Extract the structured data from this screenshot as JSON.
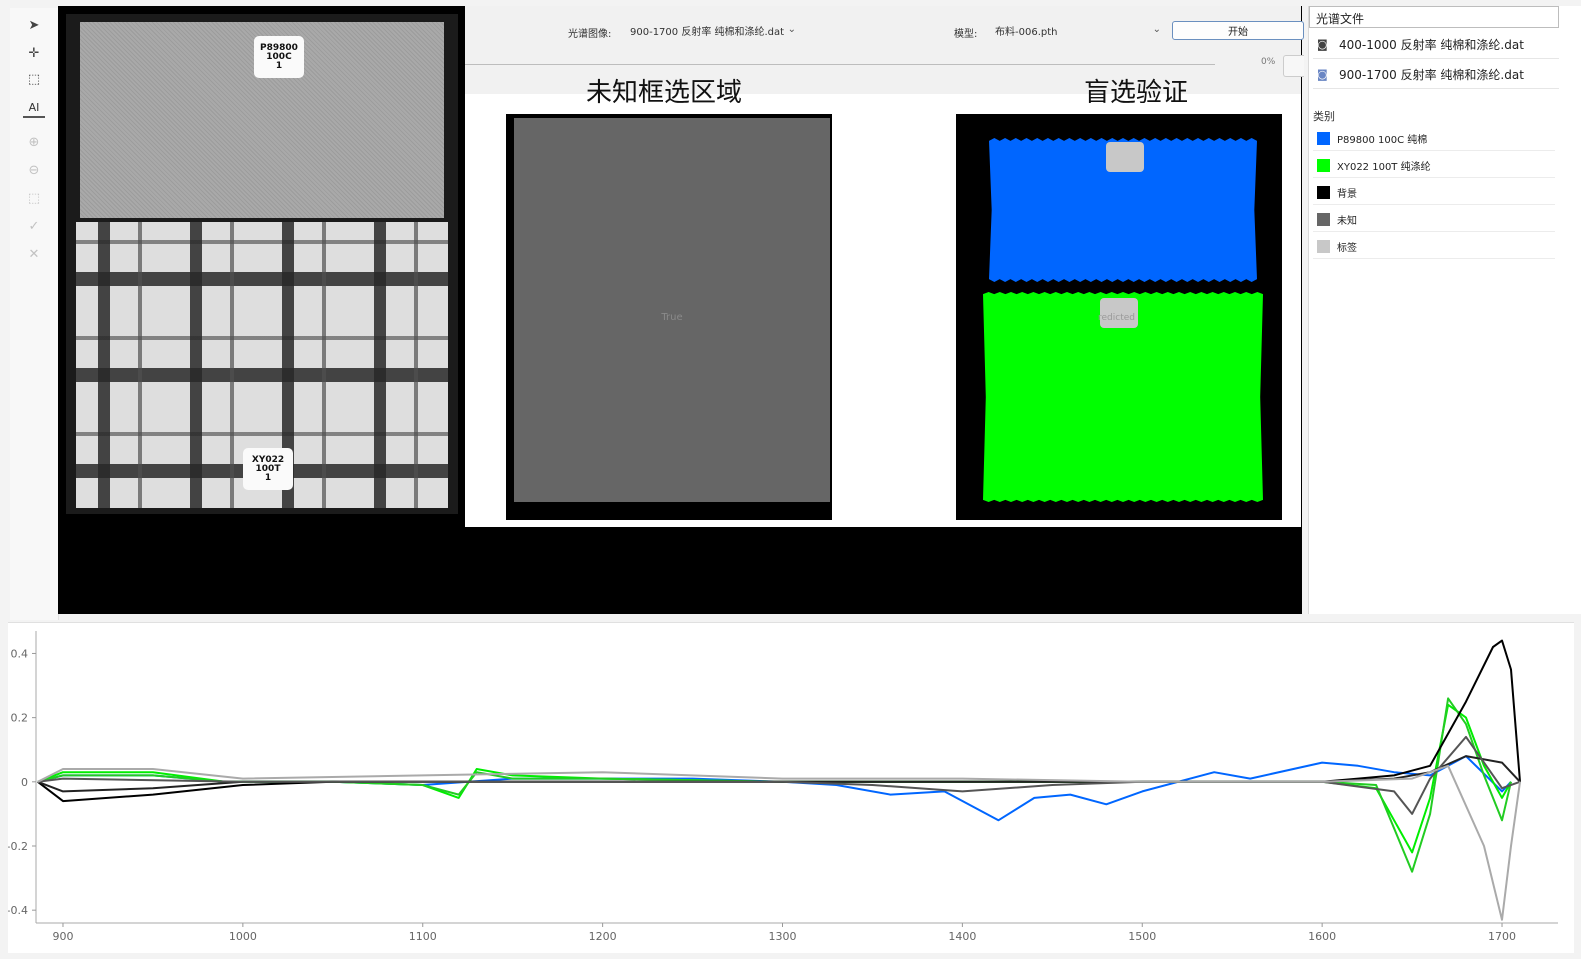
{
  "toolbar_left": {
    "tools": [
      {
        "name": "pointer-icon",
        "glyph": "➤",
        "enabled": true
      },
      {
        "name": "crosshair-icon",
        "glyph": "✛",
        "enabled": false
      },
      {
        "name": "rect-select-icon",
        "glyph": "⬚",
        "enabled": true
      },
      {
        "name": "ai-tool",
        "glyph": "AI",
        "enabled": true
      },
      {
        "name": "add-circle-icon",
        "glyph": "⊕",
        "enabled": false
      },
      {
        "name": "remove-circle-icon",
        "glyph": "⊖",
        "enabled": false
      },
      {
        "name": "rect-region-icon",
        "glyph": "⬚",
        "enabled": false
      },
      {
        "name": "check-icon",
        "glyph": "✓",
        "enabled": false
      },
      {
        "name": "close-icon",
        "glyph": "✕",
        "enabled": false
      }
    ]
  },
  "source_image": {
    "tag_top": "P89800\n100C\n1",
    "tag_bottom": "XY022\n100T\n1"
  },
  "controls": {
    "spectral_image_label": "光谱图像:",
    "spectral_image_value": "900-1700  反射率 纯棉和涤纶.dat",
    "model_label": "模型:",
    "model_value": "布料-006.pth",
    "start_button": "开始",
    "progress_text": "0%"
  },
  "figure": {
    "left_title": "未知框选区域",
    "right_title": "盲选验证",
    "left_inner_label": "True",
    "right_inner_label": "redicted"
  },
  "sidebar": {
    "files_header": "光谱文件",
    "files": [
      {
        "label": "400-1000 反射率 纯棉和涤纶.dat",
        "icon": "camera-icon"
      },
      {
        "label": "900-1700  反射率 纯棉和涤纶.dat",
        "icon": "camera-icon"
      }
    ],
    "class_header": "类别",
    "classes": [
      {
        "label": "P89800 100C 纯棉",
        "color": "#0066ff"
      },
      {
        "label": "XY022 100T 纯涤纶",
        "color": "#00ff00"
      },
      {
        "label": "背景",
        "color": "#000000"
      },
      {
        "label": "未知",
        "color": "#666666"
      },
      {
        "label": "标签",
        "color": "#c8c8c8"
      }
    ]
  },
  "chart_data": {
    "type": "line",
    "title": "",
    "xlabel": "",
    "ylabel": "",
    "xlim": [
      885,
      1720
    ],
    "ylim": [
      -0.44,
      0.47
    ],
    "xticks": [
      900,
      1000,
      1100,
      1200,
      1300,
      1400,
      1500,
      1600,
      1700
    ],
    "yticks": [
      0.4,
      0.2,
      0,
      -0.2,
      -0.4
    ],
    "ytick_labels": [
      "0.4",
      "0.2",
      "0",
      "-0.2",
      "-0.4"
    ],
    "grid": false,
    "series": [
      {
        "color": "#0066ff",
        "x": [
          886,
          900,
          950,
          990,
          1050,
          1100,
          1150,
          1200,
          1250,
          1300,
          1330,
          1360,
          1390,
          1420,
          1440,
          1460,
          1480,
          1500,
          1540,
          1560,
          1600,
          1620,
          1640,
          1660,
          1680,
          1700,
          1705
        ],
        "y": [
          0,
          0.02,
          0.02,
          0,
          0,
          -0.01,
          0.01,
          0.01,
          0.01,
          0,
          -0.01,
          -0.04,
          -0.03,
          -0.12,
          -0.05,
          -0.04,
          -0.07,
          -0.03,
          0.03,
          0.01,
          0.06,
          0.05,
          0.03,
          0.02,
          0.08,
          -0.03,
          0
        ]
      },
      {
        "color": "#00ee00",
        "x": [
          886,
          900,
          950,
          990,
          1050,
          1100,
          1120,
          1130,
          1150,
          1200,
          1300,
          1400,
          1500,
          1600,
          1630,
          1650,
          1660,
          1670,
          1680,
          1690,
          1700,
          1705
        ],
        "y": [
          0,
          0.03,
          0.03,
          0,
          0,
          -0.01,
          -0.05,
          0.04,
          0.02,
          0.01,
          0,
          0,
          0,
          0,
          -0.02,
          -0.22,
          -0.05,
          0.24,
          0.2,
          0.05,
          -0.05,
          0
        ]
      },
      {
        "color": "#22cc22",
        "x": [
          886,
          900,
          950,
          990,
          1050,
          1100,
          1120,
          1130,
          1150,
          1200,
          1300,
          1400,
          1500,
          1600,
          1630,
          1650,
          1660,
          1670,
          1680,
          1690,
          1700,
          1705
        ],
        "y": [
          0,
          0.02,
          0.02,
          0,
          0,
          -0.01,
          -0.04,
          0.03,
          0.01,
          0.01,
          0,
          0,
          0,
          0,
          -0.01,
          -0.28,
          -0.1,
          0.26,
          0.18,
          0.02,
          -0.12,
          0
        ]
      },
      {
        "color": "#000000",
        "x": [
          886,
          900,
          950,
          1000,
          1050,
          1100,
          1200,
          1300,
          1400,
          1500,
          1600,
          1620,
          1640,
          1660,
          1680,
          1695,
          1700,
          1705,
          1710
        ],
        "y": [
          0,
          -0.06,
          -0.04,
          -0.01,
          0,
          0,
          0,
          0,
          0,
          0,
          0,
          0.01,
          0.02,
          0.05,
          0.25,
          0.42,
          0.44,
          0.35,
          0
        ]
      },
      {
        "color": "#222222",
        "x": [
          886,
          900,
          950,
          1000,
          1050,
          1100,
          1200,
          1300,
          1400,
          1500,
          1600,
          1640,
          1660,
          1680,
          1700,
          1710
        ],
        "y": [
          0,
          -0.03,
          -0.02,
          0,
          0,
          0,
          0,
          0,
          0,
          0,
          0,
          0.01,
          0.03,
          0.08,
          0.06,
          0
        ]
      },
      {
        "color": "#555555",
        "x": [
          886,
          900,
          1000,
          1200,
          1300,
          1350,
          1400,
          1450,
          1500,
          1600,
          1640,
          1650,
          1660,
          1680,
          1700,
          1710
        ],
        "y": [
          0,
          0.01,
          0,
          0,
          0,
          -0.01,
          -0.03,
          -0.01,
          0,
          0,
          -0.03,
          -0.1,
          0.01,
          0.14,
          -0.02,
          0
        ]
      },
      {
        "color": "#aaaaaa",
        "x": [
          886,
          900,
          950,
          1000,
          1100,
          1200,
          1300,
          1400,
          1500,
          1600,
          1650,
          1670,
          1690,
          1700,
          1705,
          1710
        ],
        "y": [
          0,
          0.04,
          0.04,
          0.01,
          0.02,
          0.03,
          0.01,
          0.01,
          0,
          0,
          0.01,
          0.05,
          -0.2,
          -0.43,
          -0.2,
          0
        ]
      }
    ]
  }
}
